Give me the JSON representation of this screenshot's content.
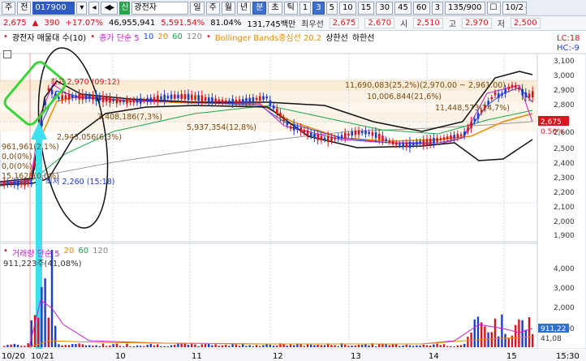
{
  "toolbar": {
    "market_select": "주",
    "type_select": "전",
    "code": "017900",
    "name": "광전자",
    "new_badge": "신",
    "period_buttons": [
      "일",
      "주",
      "월",
      "년",
      "분",
      "초",
      "틱"
    ],
    "active_period": "분",
    "interval_buttons": [
      "1",
      "3",
      "5",
      "10",
      "15",
      "30",
      "45",
      "60"
    ],
    "active_interval": "3",
    "interval_value": "3",
    "count": "135/900",
    "date": "10/2"
  },
  "quote": {
    "price": "2,675",
    "change": "390",
    "change_pct": "+17.07%",
    "volume": "46,955,941",
    "vol_pct": "5,591.54%",
    "ratio": "81.04%",
    "amount": "131,745백만",
    "best_label": "최우선",
    "best_ask": "2,675",
    "best_bid": "2,670",
    "open_label": "시",
    "open": "2,510",
    "high_label": "고",
    "high": "2,970",
    "low_label": "저",
    "low": "2,500"
  },
  "legend": {
    "title": "광전자 매물대 수(10)",
    "ma_label": "종가 단순 5",
    "ma10": "10",
    "ma20": "20",
    "ma60": "60",
    "ma120": "120",
    "bb": "Bollinger Bands중심선 20,2",
    "upper": "상한선",
    "lower": "하한선",
    "lc": "LC:18",
    "hc": "HC:-9"
  },
  "annotations": {
    "high": "최고 2,970 (09:12)",
    "low": "최저 2,260 (15:18)",
    "vp1": "11,690,083(25,2%)(2,970.00 ~ 2,961.00)",
    "vp2": "10,006,844(21,6%)",
    "vp3": "11,448,573(24,7%)",
    "vp4": "3,408,186(7,3%)",
    "vp5": "5,937,354(12,8%)",
    "vp6": "2,943,056(6,3%)",
    "vp7": "961,961(2,1%)",
    "vp8": "0,0(0%)",
    "vp9": "0,0(0%)",
    "vp10": "15,1628(0,0%)"
  },
  "price_axis": [
    "3,100",
    "3,000",
    "2,900",
    "2,800",
    "2,700",
    "2,600",
    "2,500",
    "2,400",
    "2,300",
    "2,200",
    "2,100",
    "2,000",
    "1,900"
  ],
  "price_badge": "2,675",
  "price_pct": "0.56%",
  "vol_axis": [
    "4,000",
    "3,000",
    "2,000",
    "1,000"
  ],
  "vol_unit": "911,22",
  "vol_unit2": "41,08",
  "vol_legend": {
    "label": "거래량 단순 5",
    "ma20": "20",
    "ma60": "60",
    "ma120": "120"
  },
  "vol_value": "911,223주(41,08%)",
  "x_axis": [
    "10/20",
    "10/21",
    "10",
    "11",
    "12",
    "13",
    "14",
    "15",
    "15:30"
  ],
  "colors": {
    "up": "#d9141c",
    "down": "#1d3cc9",
    "ma5": "#c81bd6",
    "ma10": "#1c4fe0",
    "ma20": "#ea8a00",
    "ma60": "#17a84a"
  }
}
